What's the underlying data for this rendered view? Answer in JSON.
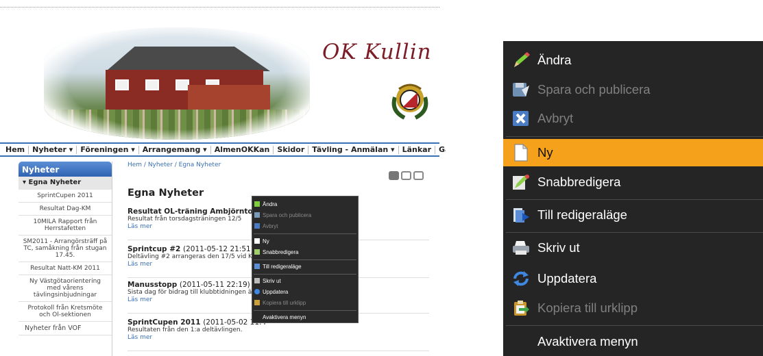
{
  "site": {
    "title": "OK Kullin",
    "nav": [
      "Hem",
      "Nyheter ▾",
      "Föreningen ▾",
      "Arrangemang ▾",
      "AlmenOKKan",
      "Skidor",
      "Tävling - Anmälan ▾",
      "Länkar",
      "Gästbok"
    ],
    "breadcrumb": "Hem / Nyheter / Egna Nyheter",
    "page_title": "Egna Nyheter",
    "sidebar": {
      "heading": "Nyheter",
      "section": "▾ Egna Nyheter",
      "items": [
        "SprintCupen 2011",
        "Resultat Dag-KM",
        "10MILA Rapport från Herrstafetten",
        "SM2011 - Arrangörsträff på TC, samåkning från stugan 17.45.",
        "Resultat Natt-KM 2011",
        "Ny Västgötaorientering med vårens tävlingsinbjudningar",
        "Protokoll från Kretsmöte och Ol-sektionen"
      ],
      "plain_item": "Nyheter från VOF"
    },
    "news": [
      {
        "title": "Resultat OL-träning Ambjörntorp",
        "meta": "",
        "text": "Resultat från torsdagsträningen 12/5",
        "more": "Läs mer"
      },
      {
        "title": "Sprintcup #2",
        "meta": "(2011-05-12 21:51)",
        "text": "Deltävling #2 arrangeras den 17/5 vid K",
        "more": "Läs mer"
      },
      {
        "title": "Manusstopp",
        "meta": "(2011-05-11 22:19)",
        "text": "Sista dag för bidrag till klubbtidningen är",
        "more": "Läs mer"
      },
      {
        "title": "SprintCupen 2011",
        "meta": "(2011-05-02 11:4",
        "text": "Resultaten från den 1:a deltävlingen.",
        "more": "Läs mer"
      }
    ]
  },
  "context_menu": {
    "items": [
      {
        "label": "Ändra",
        "icon": "pencil-icon",
        "enabled": true,
        "highlighted": false
      },
      {
        "label": "Spara och publicera",
        "icon": "save-publish-icon",
        "enabled": false,
        "highlighted": false
      },
      {
        "label": "Avbryt",
        "icon": "cancel-icon",
        "enabled": false,
        "highlighted": false
      },
      {
        "label": "Ny",
        "icon": "new-page-icon",
        "enabled": true,
        "highlighted": true
      },
      {
        "label": "Snabbredigera",
        "icon": "quick-edit-icon",
        "enabled": true,
        "highlighted": false
      },
      {
        "label": "Till redigeraläge",
        "icon": "edit-mode-icon",
        "enabled": true,
        "highlighted": false
      },
      {
        "label": "Skriv ut",
        "icon": "printer-icon",
        "enabled": true,
        "highlighted": false
      },
      {
        "label": "Uppdatera",
        "icon": "refresh-icon",
        "enabled": true,
        "highlighted": false
      },
      {
        "label": "Kopiera till urklipp",
        "icon": "clipboard-icon",
        "enabled": false,
        "highlighted": false
      },
      {
        "label": "Avaktivera menyn",
        "icon": "",
        "enabled": true,
        "highlighted": false
      }
    ]
  },
  "colors": {
    "accent": "#3a6fb5",
    "title": "#7b1d26",
    "menu_bg": "#252525",
    "menu_highlight": "#f5a11c"
  }
}
